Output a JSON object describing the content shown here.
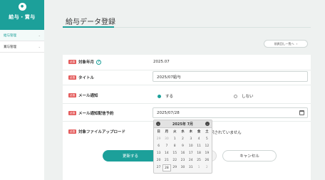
{
  "sidebar": {
    "title": "給与・賞与",
    "logo_icon": "user-icon",
    "items": [
      {
        "label": "給与管理",
        "active": true
      },
      {
        "label": "賞与管理",
        "active": false
      }
    ]
  },
  "page": {
    "title": "給与データ登録",
    "back_button": "前頁回し一覧へ"
  },
  "form": {
    "required_badge": "必須",
    "target_month": {
      "label": "対象年月",
      "value": "2025.07"
    },
    "title": {
      "label": "タイトル",
      "value": "2025/07給与"
    },
    "mail_notify": {
      "label": "メール通知",
      "option_yes": "する",
      "option_no": "しない",
      "selected": "する"
    },
    "mail_schedule": {
      "label": "メール通知配信予約",
      "value": "2025/07/28"
    },
    "upload": {
      "label": "対象ファイルアップロード",
      "note": "択されていません"
    }
  },
  "buttons": {
    "update": "更新する",
    "cancel": "キャンセル"
  },
  "calendar": {
    "month_label": "2025年 7月",
    "weekdays": [
      "日",
      "月",
      "火",
      "水",
      "木",
      "金",
      "土"
    ],
    "weeks": [
      [
        "29",
        "30",
        "1",
        "2",
        "3",
        "4",
        "5"
      ],
      [
        "6",
        "7",
        "8",
        "9",
        "10",
        "11",
        "12"
      ],
      [
        "13",
        "14",
        "15",
        "16",
        "17",
        "18",
        "19"
      ],
      [
        "20",
        "21",
        "22",
        "23",
        "24",
        "25",
        "26"
      ],
      [
        "27",
        "28",
        "29",
        "30",
        "31",
        "1",
        "2"
      ]
    ],
    "selected": "28"
  },
  "colors": {
    "accent": "#1ca09a",
    "required": "#e45c5c"
  }
}
